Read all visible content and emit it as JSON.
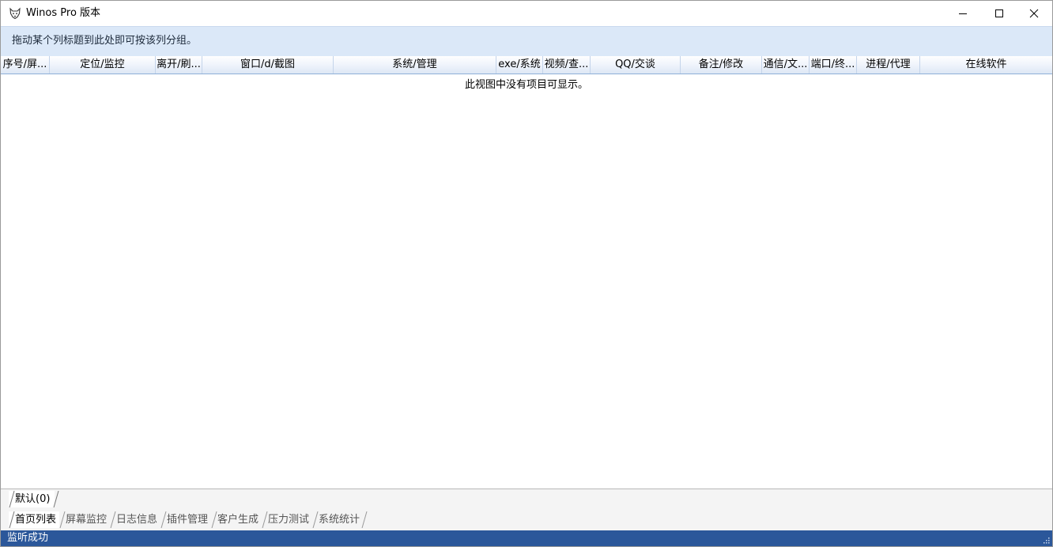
{
  "window": {
    "title": "Winos Pro 版本",
    "icon": "wolf-head-icon"
  },
  "groupbar": {
    "hint": "拖动某个列标题到此处即可按该列分组。"
  },
  "columns": [
    "序号/屏...",
    "定位/监控",
    "离开/刷...",
    "窗口/d/截图",
    "系统/管理",
    "exe/系统",
    "视频/查...",
    "QQ/交谈",
    "备注/修改",
    "通信/文...",
    "端口/终...",
    "进程/代理",
    "在线软件"
  ],
  "grid": {
    "empty_message": "此视图中没有项目可显示。"
  },
  "group_tabs": [
    {
      "label": "默认(0)",
      "active": true
    }
  ],
  "main_tabs": [
    {
      "label": "首页列表",
      "active": true
    },
    {
      "label": "屏幕监控",
      "active": false
    },
    {
      "label": "日志信息",
      "active": false
    },
    {
      "label": "插件管理",
      "active": false
    },
    {
      "label": "客户生成",
      "active": false
    },
    {
      "label": "压力测试",
      "active": false
    },
    {
      "label": "系统统计",
      "active": false
    }
  ],
  "status": {
    "text": "监听成功"
  },
  "colors": {
    "groupbar_bg": "#dbe8f8",
    "header_border": "#8fb0d8",
    "status_bg": "#2b579a"
  }
}
